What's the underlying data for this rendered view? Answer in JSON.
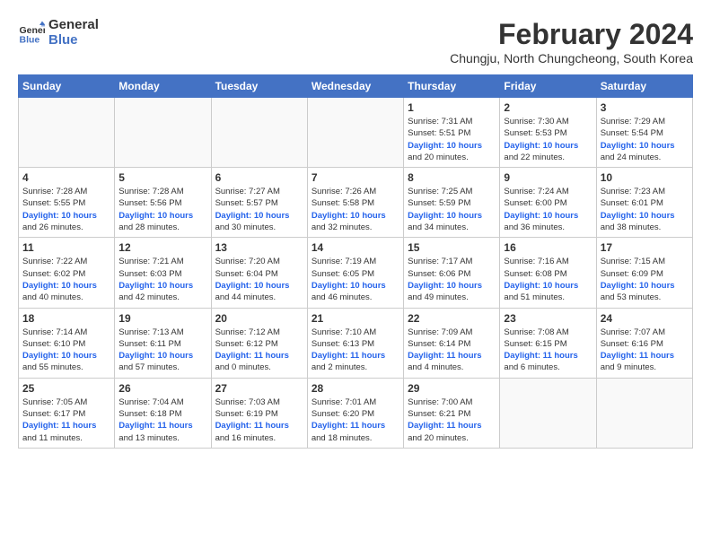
{
  "logo": {
    "line1": "General",
    "line2": "Blue"
  },
  "title": "February 2024",
  "subtitle": "Chungju, North Chungcheong, South Korea",
  "days_of_week": [
    "Sunday",
    "Monday",
    "Tuesday",
    "Wednesday",
    "Thursday",
    "Friday",
    "Saturday"
  ],
  "weeks": [
    [
      {
        "day": "",
        "info": ""
      },
      {
        "day": "",
        "info": ""
      },
      {
        "day": "",
        "info": ""
      },
      {
        "day": "",
        "info": ""
      },
      {
        "day": "1",
        "info": "Sunrise: 7:31 AM\nSunset: 5:51 PM\nDaylight: 10 hours\nand 20 minutes."
      },
      {
        "day": "2",
        "info": "Sunrise: 7:30 AM\nSunset: 5:53 PM\nDaylight: 10 hours\nand 22 minutes."
      },
      {
        "day": "3",
        "info": "Sunrise: 7:29 AM\nSunset: 5:54 PM\nDaylight: 10 hours\nand 24 minutes."
      }
    ],
    [
      {
        "day": "4",
        "info": "Sunrise: 7:28 AM\nSunset: 5:55 PM\nDaylight: 10 hours\nand 26 minutes."
      },
      {
        "day": "5",
        "info": "Sunrise: 7:28 AM\nSunset: 5:56 PM\nDaylight: 10 hours\nand 28 minutes."
      },
      {
        "day": "6",
        "info": "Sunrise: 7:27 AM\nSunset: 5:57 PM\nDaylight: 10 hours\nand 30 minutes."
      },
      {
        "day": "7",
        "info": "Sunrise: 7:26 AM\nSunset: 5:58 PM\nDaylight: 10 hours\nand 32 minutes."
      },
      {
        "day": "8",
        "info": "Sunrise: 7:25 AM\nSunset: 5:59 PM\nDaylight: 10 hours\nand 34 minutes."
      },
      {
        "day": "9",
        "info": "Sunrise: 7:24 AM\nSunset: 6:00 PM\nDaylight: 10 hours\nand 36 minutes."
      },
      {
        "day": "10",
        "info": "Sunrise: 7:23 AM\nSunset: 6:01 PM\nDaylight: 10 hours\nand 38 minutes."
      }
    ],
    [
      {
        "day": "11",
        "info": "Sunrise: 7:22 AM\nSunset: 6:02 PM\nDaylight: 10 hours\nand 40 minutes."
      },
      {
        "day": "12",
        "info": "Sunrise: 7:21 AM\nSunset: 6:03 PM\nDaylight: 10 hours\nand 42 minutes."
      },
      {
        "day": "13",
        "info": "Sunrise: 7:20 AM\nSunset: 6:04 PM\nDaylight: 10 hours\nand 44 minutes."
      },
      {
        "day": "14",
        "info": "Sunrise: 7:19 AM\nSunset: 6:05 PM\nDaylight: 10 hours\nand 46 minutes."
      },
      {
        "day": "15",
        "info": "Sunrise: 7:17 AM\nSunset: 6:06 PM\nDaylight: 10 hours\nand 49 minutes."
      },
      {
        "day": "16",
        "info": "Sunrise: 7:16 AM\nSunset: 6:08 PM\nDaylight: 10 hours\nand 51 minutes."
      },
      {
        "day": "17",
        "info": "Sunrise: 7:15 AM\nSunset: 6:09 PM\nDaylight: 10 hours\nand 53 minutes."
      }
    ],
    [
      {
        "day": "18",
        "info": "Sunrise: 7:14 AM\nSunset: 6:10 PM\nDaylight: 10 hours\nand 55 minutes."
      },
      {
        "day": "19",
        "info": "Sunrise: 7:13 AM\nSunset: 6:11 PM\nDaylight: 10 hours\nand 57 minutes."
      },
      {
        "day": "20",
        "info": "Sunrise: 7:12 AM\nSunset: 6:12 PM\nDaylight: 11 hours\nand 0 minutes."
      },
      {
        "day": "21",
        "info": "Sunrise: 7:10 AM\nSunset: 6:13 PM\nDaylight: 11 hours\nand 2 minutes."
      },
      {
        "day": "22",
        "info": "Sunrise: 7:09 AM\nSunset: 6:14 PM\nDaylight: 11 hours\nand 4 minutes."
      },
      {
        "day": "23",
        "info": "Sunrise: 7:08 AM\nSunset: 6:15 PM\nDaylight: 11 hours\nand 6 minutes."
      },
      {
        "day": "24",
        "info": "Sunrise: 7:07 AM\nSunset: 6:16 PM\nDaylight: 11 hours\nand 9 minutes."
      }
    ],
    [
      {
        "day": "25",
        "info": "Sunrise: 7:05 AM\nSunset: 6:17 PM\nDaylight: 11 hours\nand 11 minutes."
      },
      {
        "day": "26",
        "info": "Sunrise: 7:04 AM\nSunset: 6:18 PM\nDaylight: 11 hours\nand 13 minutes."
      },
      {
        "day": "27",
        "info": "Sunrise: 7:03 AM\nSunset: 6:19 PM\nDaylight: 11 hours\nand 16 minutes."
      },
      {
        "day": "28",
        "info": "Sunrise: 7:01 AM\nSunset: 6:20 PM\nDaylight: 11 hours\nand 18 minutes."
      },
      {
        "day": "29",
        "info": "Sunrise: 7:00 AM\nSunset: 6:21 PM\nDaylight: 11 hours\nand 20 minutes."
      },
      {
        "day": "",
        "info": ""
      },
      {
        "day": "",
        "info": ""
      }
    ]
  ]
}
